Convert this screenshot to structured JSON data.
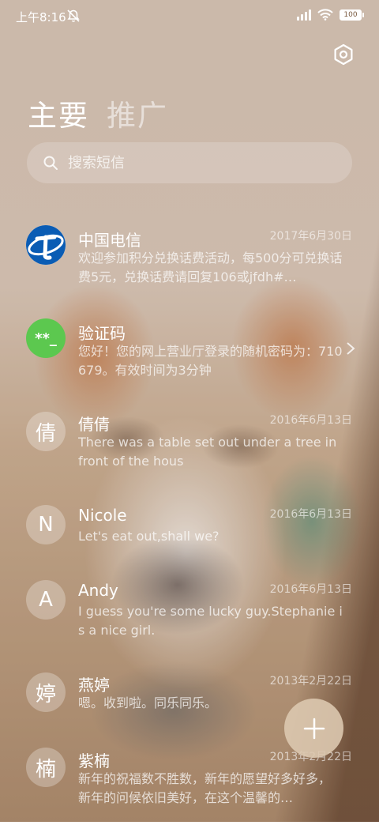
{
  "status_bar": {
    "time": "上午8:16",
    "battery": "100",
    "icons": [
      "do-not-disturb-icon",
      "signal-icon",
      "wifi-icon",
      "battery-icon"
    ]
  },
  "header": {
    "tabs": [
      {
        "label": "主要",
        "active": true
      },
      {
        "label": "推广",
        "active": false
      }
    ],
    "settings_icon": "settings-hexagon-icon"
  },
  "search": {
    "placeholder": "搜索短信",
    "value": ""
  },
  "conversations": [
    {
      "name": "中国电信",
      "date": "2017年6月30日",
      "preview": "欢迎参加积分兑换话费活动，每500分可兑换话费5元，兑换话费请回复106或jfdh#…",
      "avatar": "china-telecom-logo"
    },
    {
      "name": "验证码",
      "date": "",
      "preview": "您好！您的网上营业厅登录的随机密码为：710679。有效时间为3分钟",
      "avatar_text": "**_",
      "avatar_color": "#5cc84f"
    },
    {
      "name": "倩倩",
      "date": "2016年6月13日",
      "preview": "There was a table set out under a tree in front of the hous",
      "avatar_text": "倩"
    },
    {
      "name": "Nicole",
      "date": "2016年6月13日",
      "preview": "Let's eat out,shall we?",
      "avatar_text": "N"
    },
    {
      "name": "Andy",
      "date": "2016年6月13日",
      "preview": "I guess you're some lucky guy.Stephanie is a nice girl.",
      "avatar_text": "A"
    },
    {
      "name": "燕婷",
      "date": "2013年2月22日",
      "preview": "嗯。收到啦。同乐同乐。",
      "avatar_text": "婷"
    },
    {
      "name": "紫楠",
      "date": "2013年2月22日",
      "preview": "新年的祝福数不胜数，新年的愿望好多好多，新年的问候依旧美好，在这个温馨的…",
      "avatar_text": "楠"
    }
  ],
  "fab": {
    "icon": "plus-icon"
  }
}
